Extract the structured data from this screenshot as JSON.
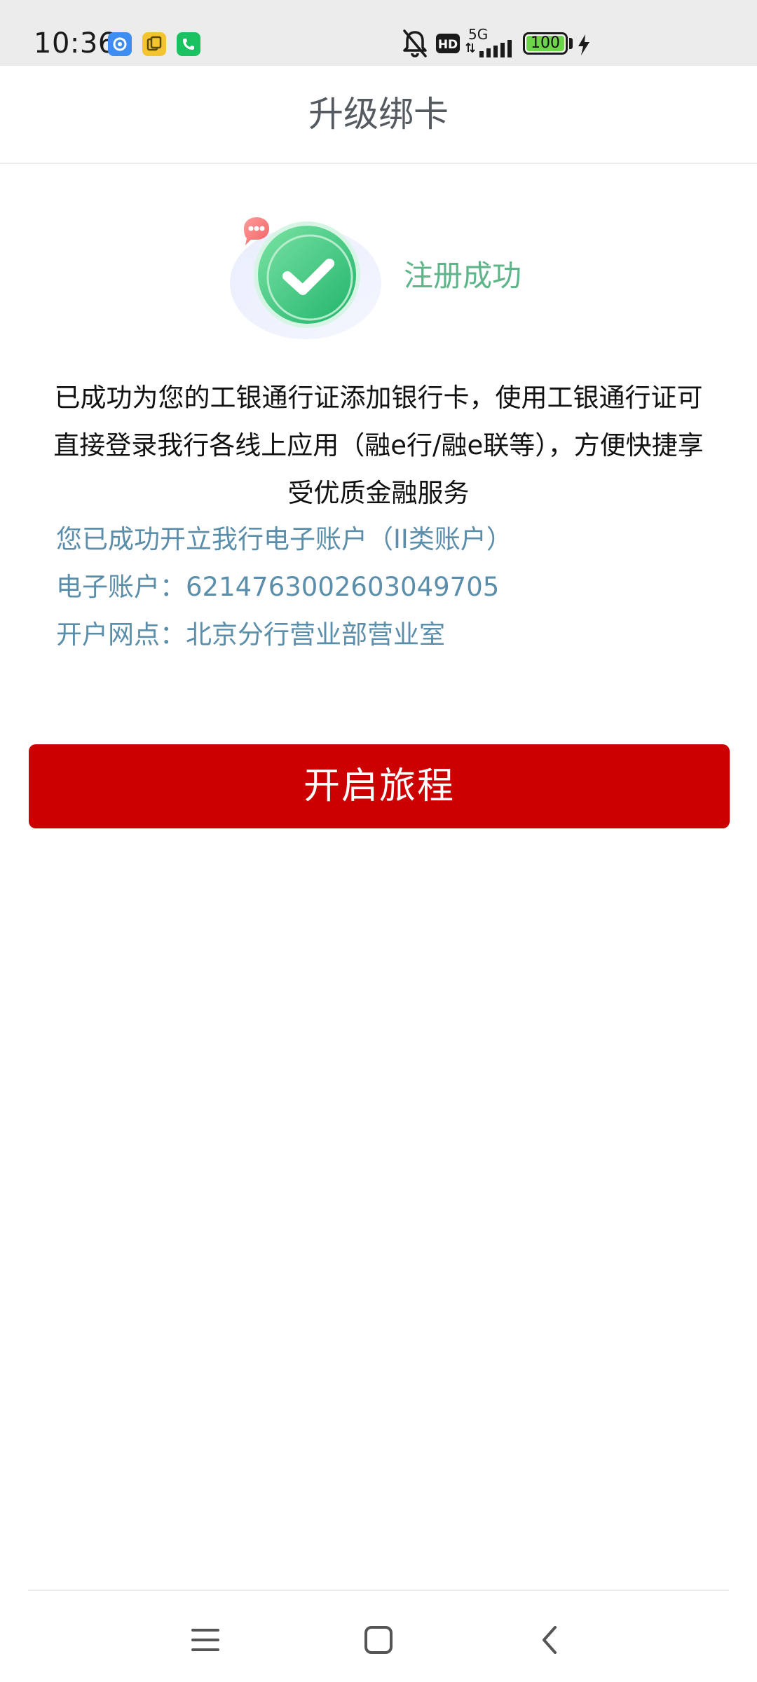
{
  "status_bar": {
    "time": "10:36",
    "network": "5G",
    "hd_badge": "HD",
    "battery": "100",
    "icons": [
      "app-blue-icon",
      "app-yellow-icon",
      "phone-icon",
      "bell-off-icon",
      "hd-icon",
      "signal-icon",
      "battery-icon",
      "charging-bolt-icon"
    ]
  },
  "header": {
    "title": "升级绑卡"
  },
  "success": {
    "title": "注册成功",
    "icon": "check-success-icon",
    "description": "已成功为您的工银通行证添加银行卡，使用工银通行证可直接登录我行各线上应用（融e行/融e联等），方便快捷享受优质金融服务"
  },
  "account_info": {
    "opened_notice": "您已成功开立我行电子账户（II类账户）",
    "account_label": "电子账户：",
    "account_number": "6214763002603049705",
    "branch_label": "开户网点：",
    "branch_value": "北京分行营业部营业室"
  },
  "actions": {
    "start_label": "开启旅程"
  },
  "colors": {
    "primary_button": "#cc0000",
    "success_green": "#5fb58a",
    "info_blue": "#5b8eaa",
    "title_gray": "#555a60"
  },
  "nav": {
    "items": [
      "menu-icon",
      "home-icon",
      "back-icon"
    ]
  }
}
